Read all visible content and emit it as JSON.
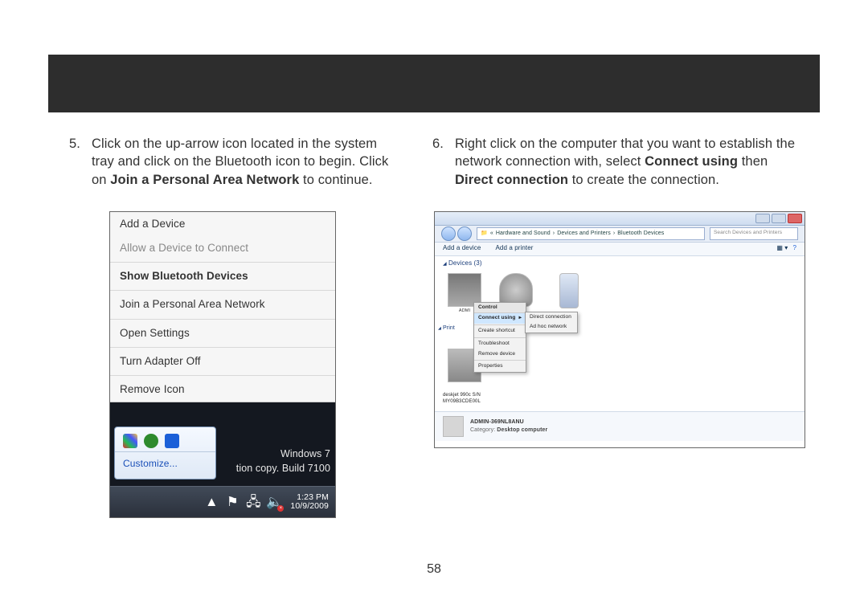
{
  "page_number": "58",
  "left": {
    "num": "5.",
    "text_before_bold": "Click on the up-arrow icon located in the system tray and click on the Bluetooth icon to begin.  Click on ",
    "bold": "Join a Personal Area Network",
    "text_after_bold": " to continue.",
    "menu": {
      "add_device": "Add a Device",
      "allow_connect": "Allow a Device to Connect",
      "show_bt": "Show Bluetooth Devices",
      "join_pan": "Join a Personal Area Network",
      "open_settings": "Open Settings",
      "turn_off": "Turn Adapter Off",
      "remove_icon": "Remove Icon"
    },
    "customize": "Customize...",
    "os_label": "Windows 7",
    "build_label": "tion copy. Build 7100",
    "time": "1:23 PM",
    "date": "10/9/2009"
  },
  "right": {
    "num": "6.",
    "text_before_b1": "Right click on the computer that you want to establish the network connection with, select ",
    "bold1": "Connect using",
    "mid": " then ",
    "bold2": "Direct connection",
    "text_after_b2": " to create the connection.",
    "breadcrumb": {
      "p1": "Hardware and Sound",
      "p2": "Devices and Printers",
      "p3": "Bluetooth Devices"
    },
    "search_placeholder": "Search Devices and Printers",
    "toolbar": {
      "add_device": "Add a device",
      "add_printer": "Add a printer"
    },
    "section_devices": "Devices (3)",
    "section_printers": "Print",
    "ctx": {
      "header": "Control",
      "connect_using": "Connect using",
      "create_shortcut": "Create shortcut",
      "troubleshoot": "Troubleshoot",
      "remove_device": "Remove device",
      "properties": "Properties"
    },
    "sub": {
      "direct": "Direct connection",
      "adhoc": "Ad hoc network"
    },
    "printer_caption_top": "deskjet 990c S/N",
    "printer_caption_bottom": "MY09B3CDE00L",
    "details": {
      "name": "ADMIN-369NL8ANU",
      "category_label": "Category:",
      "category_value": "Desktop computer"
    }
  }
}
